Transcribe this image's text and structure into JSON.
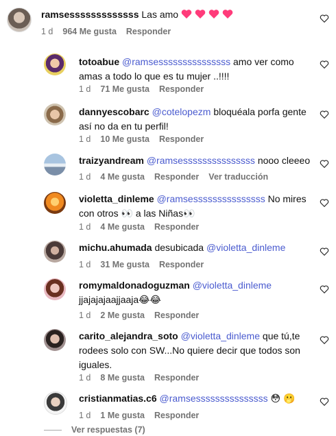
{
  "comments": [
    {
      "user": "ramsesssssssssssss",
      "body": "Las amo",
      "hearts": 4,
      "time": "1 d",
      "likes": "964 Me gusta",
      "reply": "Responder"
    },
    {
      "user": "totoabue",
      "mention": "@ramsesssssssssssssss",
      "body": "amo ver como amas a todo lo que es tu mujer ..!!!!",
      "time": "1 d",
      "likes": "71 Me gusta",
      "reply": "Responder"
    },
    {
      "user": "dannyescobarc",
      "mention": "@cotelopezm",
      "body": "bloquéala porfa gente así no da en tu perfil!",
      "time": "1 d",
      "likes": "10 Me gusta",
      "reply": "Responder"
    },
    {
      "user": "traizyandream",
      "mention": "@ramsesssssssssssssss",
      "body": "nooo cleeeo",
      "time": "1 d",
      "likes": "4 Me gusta",
      "reply": "Responder",
      "translate": "Ver traducción"
    },
    {
      "user": "violetta_dinleme",
      "mention": "@ramsesssssssssssssss",
      "body": "No mires con otros",
      "body2": "a las Niñas",
      "time": "1 d",
      "likes": "4 Me gusta",
      "reply": "Responder"
    },
    {
      "user": "michu.ahumada",
      "body": "desubicada",
      "mention": "@violetta_dinleme",
      "time": "1 d",
      "likes": "31 Me gusta",
      "reply": "Responder"
    },
    {
      "user": "romymaldonadoguzman",
      "mention": "@violetta_dinleme",
      "body": "jjajajajaajjaaja",
      "time": "1 d",
      "likes": "2 Me gusta",
      "reply": "Responder"
    },
    {
      "user": "carito_alejandra_soto",
      "mention": "@violetta_dinleme",
      "body": "que tú,te rodees solo con SW...No quiere decir que todos son iguales.",
      "time": "1 d",
      "likes": "8 Me gusta",
      "reply": "Responder"
    },
    {
      "user": "cristianmatias.c6",
      "mention": "@ramsesssssssssssssss",
      "body": "",
      "time": "1 d",
      "likes": "1 Me gusta",
      "reply": "Responder"
    }
  ],
  "view_replies": "Ver respuestas (7)",
  "colors": {
    "mention": "#4a5bcf",
    "meta": "#737373",
    "heart": "#ff3b7a"
  }
}
